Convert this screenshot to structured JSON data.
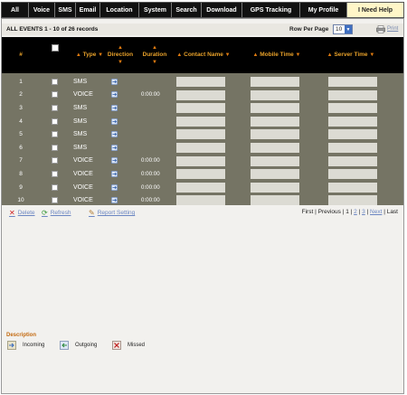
{
  "tabs": [
    {
      "label": "All",
      "active": false
    },
    {
      "label": "Voice",
      "active": false
    },
    {
      "label": "SMS",
      "active": false
    },
    {
      "label": "Email",
      "active": false
    },
    {
      "label": "Location",
      "active": false
    },
    {
      "label": "System",
      "active": false
    },
    {
      "label": "Search",
      "active": false
    },
    {
      "label": "Download",
      "active": false
    },
    {
      "label": "GPS Tracking",
      "active": false
    },
    {
      "label": "My Profile",
      "active": false
    },
    {
      "label": "I Need Help",
      "active": true
    }
  ],
  "grid": {
    "title": "ALL EVENTS 1 - 10 of 26 records",
    "rows_per_page_label": "Row Per Page",
    "rows_per_page_value": "10",
    "print_label": "Print"
  },
  "columns": {
    "num": "#",
    "type": "Type",
    "direction": "Direction",
    "duration": "Duration",
    "contact": "Contact Name",
    "mobile": "Mobile Time",
    "server": "Server Time"
  },
  "rows": [
    {
      "num": "1",
      "type": "SMS",
      "duration": ""
    },
    {
      "num": "2",
      "type": "VOICE",
      "duration": "0:00:00"
    },
    {
      "num": "3",
      "type": "SMS",
      "duration": ""
    },
    {
      "num": "4",
      "type": "SMS",
      "duration": ""
    },
    {
      "num": "5",
      "type": "SMS",
      "duration": ""
    },
    {
      "num": "6",
      "type": "SMS",
      "duration": ""
    },
    {
      "num": "7",
      "type": "VOICE",
      "duration": "0:00:00"
    },
    {
      "num": "8",
      "type": "VOICE",
      "duration": "0:00:00"
    },
    {
      "num": "9",
      "type": "VOICE",
      "duration": "0:00:00"
    },
    {
      "num": "10",
      "type": "VOICE",
      "duration": "0:00:00"
    }
  ],
  "controls": {
    "delete": "Delete",
    "refresh": "Refresh",
    "report": "Report Setting"
  },
  "pager": {
    "first": "First",
    "sep1": " | ",
    "previous": "Previous",
    "sep2": " | ",
    "page1": "1",
    "sep3": " | ",
    "page2": "2",
    "sep4": " | ",
    "page3": "3",
    "sep5": " | ",
    "next": "Next",
    "sep6": " | ",
    "last": "Last"
  },
  "legend": {
    "title": "Description",
    "incoming": "Incoming",
    "outgoing": "Outgoing",
    "missed": "Missed"
  },
  "colors": {
    "tab_bar": "#111111",
    "active_tab": "#fff6c8",
    "header_text": "#e8a12a",
    "table_body": "#757464",
    "input_box": "#dcdbd3",
    "link": "#6b86c2"
  }
}
